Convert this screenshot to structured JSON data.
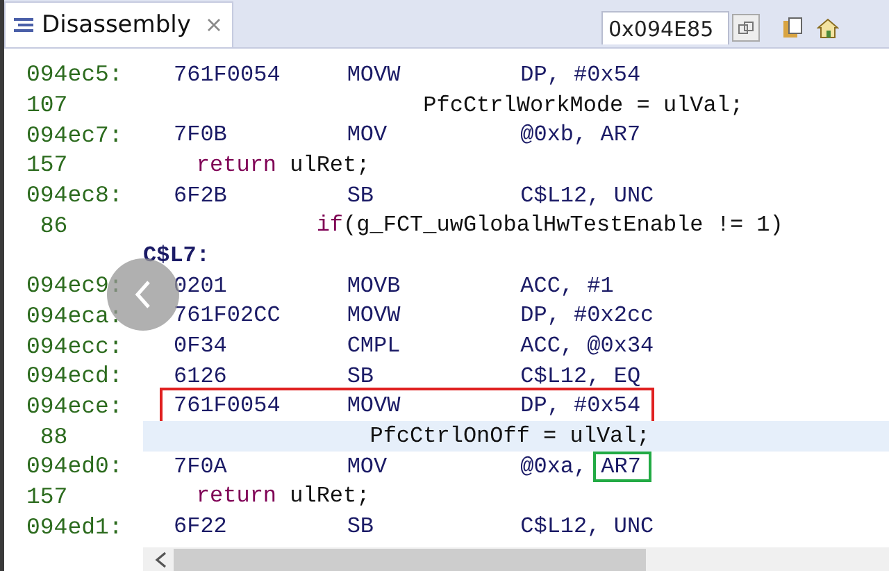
{
  "tabs": [
    {
      "label": "Disassembly",
      "selected": true
    }
  ],
  "address_field": {
    "value": "0x094E85"
  },
  "rows": [
    {
      "kind": "instruction",
      "address": "094ec5:",
      "opcode": "761F0054",
      "mnemonic": "MOVW",
      "operands": "DP, #0x54",
      "current": false,
      "outlined": false
    },
    {
      "kind": "source",
      "line": "107",
      "keyword": "",
      "code": "                     PfcCtrlWorkMode = ulVal;",
      "current": false
    },
    {
      "kind": "instruction",
      "address": "094ec7:",
      "opcode": "7F0B",
      "mnemonic": "MOV",
      "operands": "@0xb, AR7",
      "current": false,
      "outlined": false
    },
    {
      "kind": "source",
      "line": "157",
      "keyword": "    return",
      "code": " ulRet;",
      "current": false
    },
    {
      "kind": "instruction",
      "address": "094ec8:",
      "opcode": "6F2B",
      "mnemonic": "SB",
      "operands": "C$L12, UNC",
      "current": false,
      "outlined": false
    },
    {
      "kind": "source",
      "line": " 86",
      "keyword": "             if",
      "code": "(g_FCT_uwGlobalHwTestEnable != 1)",
      "current": false
    },
    {
      "kind": "label",
      "text": "C$L7:"
    },
    {
      "kind": "instruction",
      "address": "094ec9:",
      "opcode": "0201",
      "mnemonic": "MOVB",
      "operands": "ACC, #1",
      "current": false,
      "outlined": false
    },
    {
      "kind": "instruction",
      "address": "094eca:",
      "opcode": "761F02CC",
      "mnemonic": "MOVW",
      "operands": "DP, #0x2cc",
      "current": false,
      "outlined": false
    },
    {
      "kind": "instruction",
      "address": "094ecc:",
      "opcode": "0F34",
      "mnemonic": "CMPL",
      "operands": "ACC, @0x34",
      "current": false,
      "outlined": false
    },
    {
      "kind": "instruction",
      "address": "094ecd:",
      "opcode": "6126",
      "mnemonic": "SB",
      "operands": "C$L12, EQ",
      "current": false,
      "outlined": false
    },
    {
      "kind": "instruction",
      "address": "094ece:",
      "opcode": "761F0054",
      "mnemonic": "MOVW",
      "operands": "DP, #0x54",
      "current": false,
      "outlined": true
    },
    {
      "kind": "source",
      "line": " 88",
      "keyword": "",
      "code": "                 PfcCtrlOnOff = ulVal;",
      "current": true
    },
    {
      "kind": "instruction",
      "address": "094ed0:",
      "opcode": "7F0A",
      "mnemonic": "MOV",
      "operands": "@0xa,",
      "boxed_operand": "AR7",
      "current": false,
      "outlined": false
    },
    {
      "kind": "source",
      "line": "157",
      "keyword": "    return",
      "code": " ulRet;",
      "current": false
    },
    {
      "kind": "instruction",
      "address": "094ed1:",
      "opcode": "6F22",
      "mnemonic": "SB",
      "operands": "C$L12, UNC",
      "current": false,
      "outlined": false
    }
  ]
}
